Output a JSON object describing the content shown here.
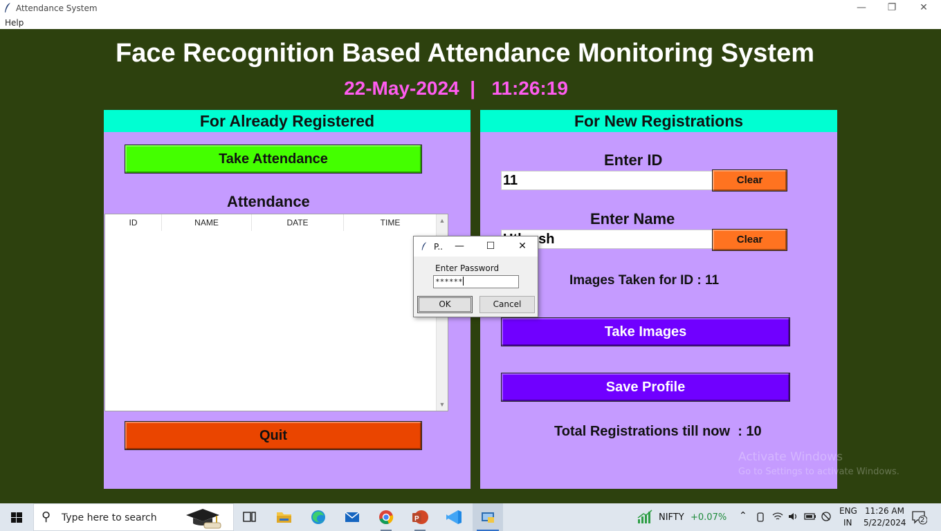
{
  "window": {
    "title": "Attendance System",
    "menu": [
      "Help"
    ],
    "controls": {
      "minimize": "—",
      "maximize": "❐",
      "close": "✕"
    }
  },
  "header": {
    "title": "Face Recognition Based Attendance Monitoring System",
    "datetime": "22-May-2024  |   11:26:19"
  },
  "left_panel": {
    "heading": "For Already Registered",
    "take_attendance_label": "Take Attendance",
    "attendance_label": "Attendance",
    "table": {
      "columns": [
        "ID",
        "NAME",
        "DATE",
        "TIME"
      ],
      "rows": []
    },
    "quit_label": "Quit"
  },
  "right_panel": {
    "heading": "For New Registrations",
    "enter_id_label": "Enter ID",
    "id_value": "11",
    "clear_label": "Clear",
    "enter_name_label": "Enter Name",
    "name_value": "Utkarsh",
    "images_taken_text": "Images Taken for ID : 11",
    "take_images_label": "Take Images",
    "save_profile_label": "Save Profile",
    "total_registrations_text": "Total Registrations till now  : 10"
  },
  "dialog": {
    "title": "P..",
    "prompt": "Enter Password",
    "value": "******",
    "ok_label": "OK",
    "cancel_label": "Cancel"
  },
  "watermark": {
    "line1": "Activate Windows",
    "line2": "Go to Settings to activate Windows."
  },
  "taskbar": {
    "search_placeholder": "Type here to search",
    "stock_name": "NIFTY",
    "stock_change": "+0.07%",
    "lang_line1": "ENG",
    "lang_line2": "IN",
    "time": "11:26 AM",
    "date": "5/22/2024",
    "notification_count": "2"
  },
  "colors": {
    "background": "#2d410e",
    "panel": "#c59bff",
    "panel_header": "#00ffd2",
    "take_attendance": "#44ff00",
    "quit": "#ea4500",
    "clear": "#ff7320",
    "purple_button": "#7000ff",
    "datetime": "#ff5cf0"
  }
}
